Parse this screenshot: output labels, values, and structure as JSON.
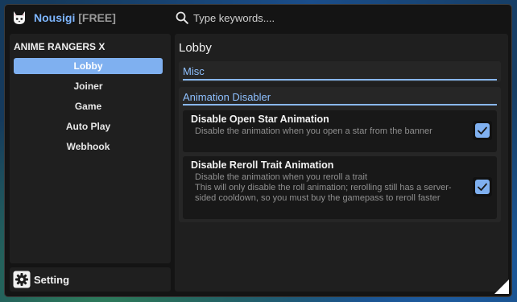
{
  "app": {
    "name": "Nousigi",
    "tag": "[FREE]",
    "logo_icon": "cat-logo-icon"
  },
  "search": {
    "placeholder": "Type keywords...."
  },
  "sidebar": {
    "heading": "ANIME RANGERS X",
    "items": [
      {
        "label": "Lobby",
        "active": true
      },
      {
        "label": "Joiner",
        "active": false
      },
      {
        "label": "Game",
        "active": false
      },
      {
        "label": "Auto Play",
        "active": false
      },
      {
        "label": "Webhook",
        "active": false
      }
    ]
  },
  "setting": {
    "label": "Setting",
    "icon": "gear-icon"
  },
  "main": {
    "title": "Lobby",
    "sections": [
      {
        "title": "Misc"
      },
      {
        "title": "Animation Disabler",
        "options": [
          {
            "title": "Disable Open Star Animation",
            "description": "Disable the animation when you open a star from the banner",
            "checked": true
          },
          {
            "title": "Disable Reroll Trait Animation",
            "description": "Disable the animation when you reroll a trait\nThis will only disable the roll animation; rerolling still has a server-sided cooldown, so you must buy the gamepass to reroll faster",
            "checked": true
          }
        ]
      }
    ]
  },
  "colors": {
    "accent": "#7fb0f0",
    "section_title": "#8ec0ff",
    "panel": "#1f1f1f",
    "window": "#141414"
  }
}
